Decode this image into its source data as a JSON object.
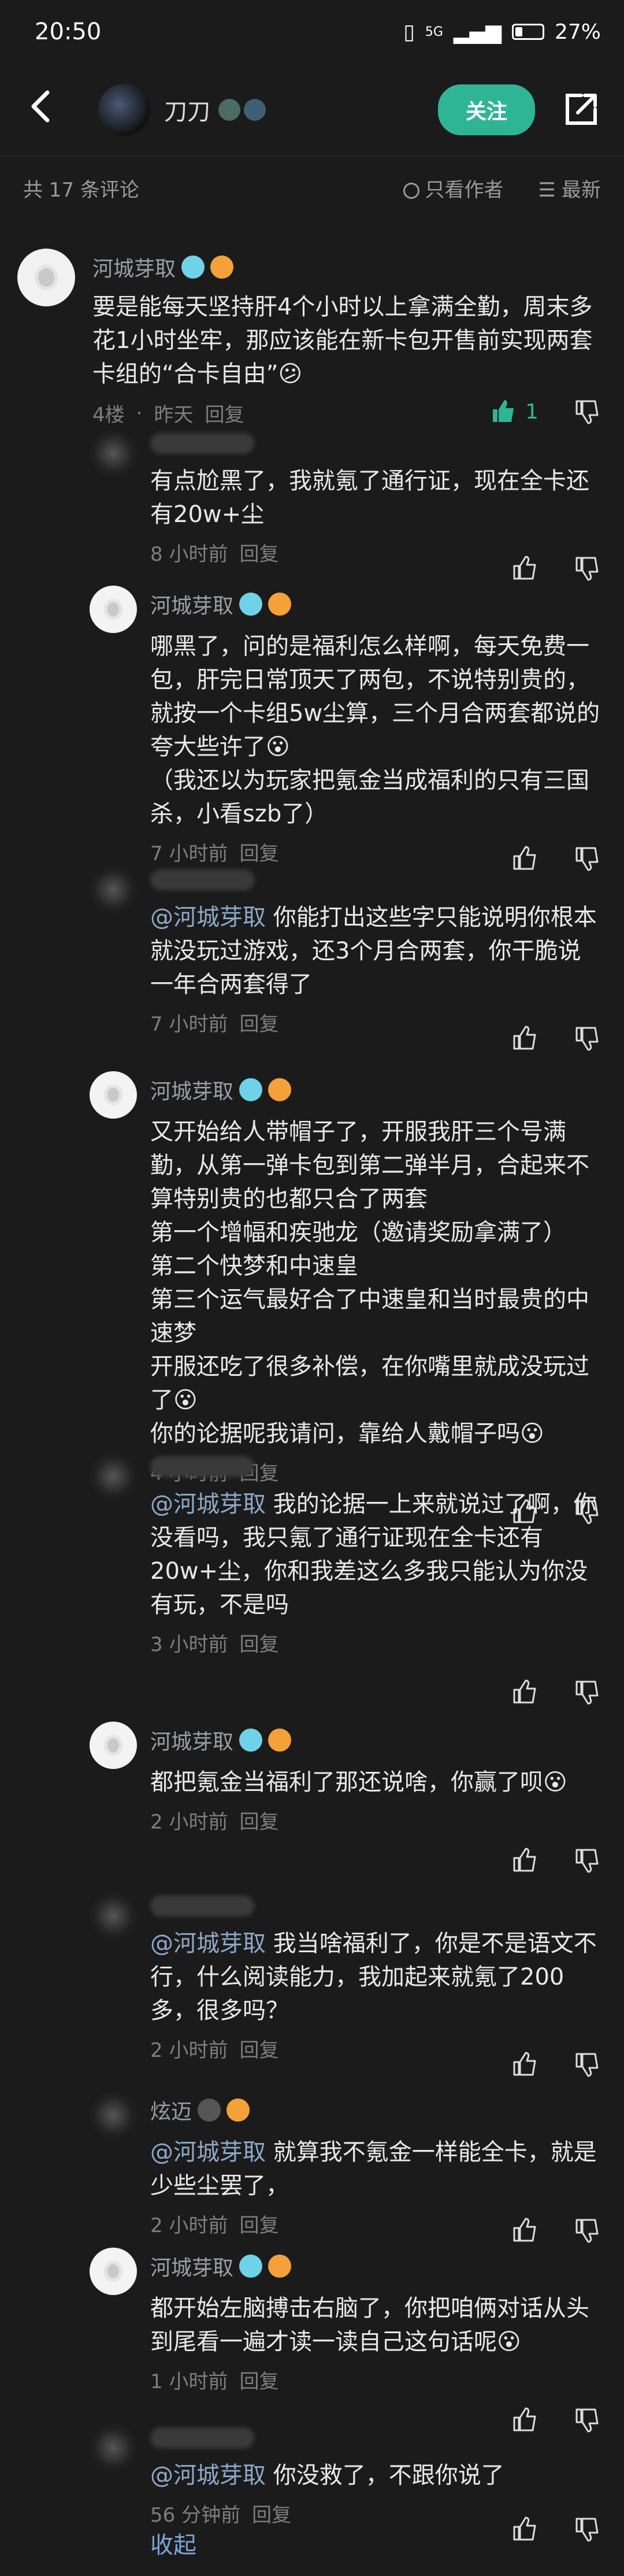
{
  "status": {
    "time": "20:50",
    "network": "5G",
    "battery": "27%"
  },
  "nav": {
    "username": "刀刀",
    "follow_label": "关注"
  },
  "comments_header": {
    "count_label": "共 17 条评论",
    "only_author": "只看作者",
    "latest": "最新"
  },
  "main_comment": {
    "user": "河城芽取",
    "text": "要是能每天坚持肝4个小时以上拿满全勤，周末多花1小时坐牢，那应该能在新卡包开售前实现两套卡组的“合卡自由”😕",
    "meta_floor": "4楼",
    "meta_time": "昨天",
    "meta_reply": "回复",
    "likes": "1"
  },
  "replies": [
    {
      "user": "",
      "mention": "",
      "text": "有点尬黑了，我就氪了通行证，现在全卡还有20w+尘",
      "time": "8 小时前",
      "reply": "回复"
    },
    {
      "user": "河城芽取",
      "mention": "",
      "text": "哪黑了，问的是福利怎么样啊，每天免费一包，肝完日常顶天了两包，不说特别贵的，就按一个卡组5w尘算，三个月合两套都说的夸大些许了😮\n（我还以为玩家把氪金当成福利的只有三国杀，小看szb了）",
      "time": "7 小时前",
      "reply": "回复"
    },
    {
      "user": "",
      "mention": "@河城芽取",
      "text": " 你能打出这些字只能说明你根本就没玩过游戏，还3个月合两套，你干脆说一年合两套得了",
      "time": "7 小时前",
      "reply": "回复"
    },
    {
      "user": "河城芽取",
      "mention": "",
      "text": "又开始给人带帽子了，开服我肝三个号满勤，从第一弹卡包到第二弹半月，合起来不算特别贵的也都只合了两套\n第一个增幅和疾驰龙（邀请奖励拿满了）\n第二个快梦和中速皇\n第三个运气最好合了中速皇和当时最贵的中速梦\n开服还吃了很多补偿，在你嘴里就成没玩过了😮\n你的论据呢我请问，靠给人戴帽子吗😮",
      "time": "4 小时前",
      "reply": "回复"
    },
    {
      "user": "",
      "mention": "@河城芽取",
      "text": " 我的论据一上来就说过了啊，你没看吗，我只氪了通行证现在全卡还有20w+尘，你和我差这么多我只能认为你没有玩，不是吗",
      "time": "3 小时前",
      "reply": "回复"
    },
    {
      "user": "河城芽取",
      "mention": "",
      "text": "都把氪金当福利了那还说啥，你赢了呗😮",
      "time": "2 小时前",
      "reply": "回复"
    },
    {
      "user": "",
      "mention": "@河城芽取",
      "text": " 我当啥福利了，你是不是语文不行，什么阅读能力，我加起来就氪了200多，很多吗？",
      "time": "2 小时前",
      "reply": "回复"
    },
    {
      "user": "炫迈",
      "mention": "@河城芽取",
      "text": " 就算我不氪金一样能全卡，就是少些尘罢了，",
      "time": "2 小时前",
      "reply": "回复"
    },
    {
      "user": "河城芽取",
      "mention": "",
      "text": "都开始左脑搏击右脑了，你把咱俩对话从头到尾看一遍才读一读自己这句话呢😮",
      "time": "1 小时前",
      "reply": "回复"
    },
    {
      "user": "",
      "mention": "@河城芽取",
      "text": " 你没救了，不跟你说了",
      "time": "56 分钟前",
      "reply": "回复"
    }
  ],
  "collapse_label": "收起",
  "icons": {
    "accent": "#2fb596",
    "names": [
      "back-icon",
      "share-icon",
      "like-icon",
      "dislike-icon",
      "sort-icon",
      "radio-icon"
    ]
  }
}
